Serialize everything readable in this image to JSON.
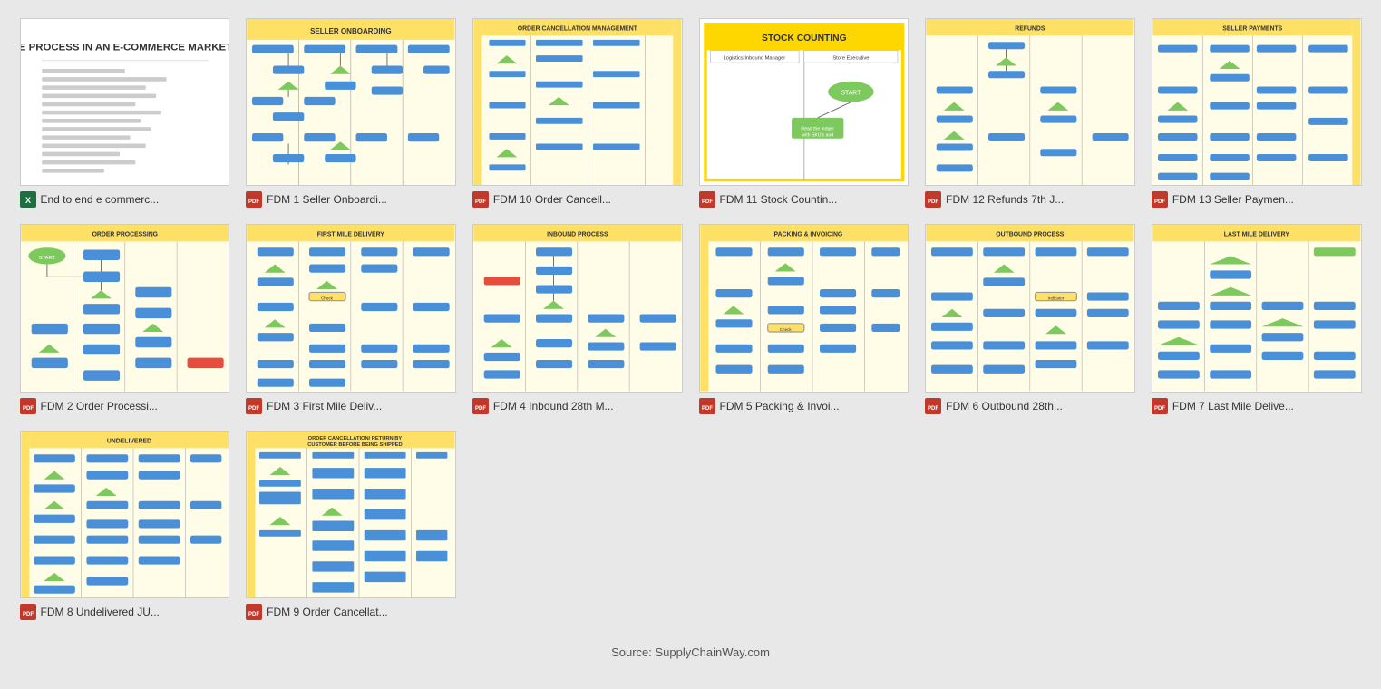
{
  "source": "Source: SupplyChainWay.com",
  "items": [
    {
      "id": "item-0",
      "label": "End to end e commerc...",
      "icon_type": "xlsx",
      "thumb_type": "text_doc"
    },
    {
      "id": "item-1",
      "label": "FDM 1 Seller Onboardi...",
      "icon_type": "pdf",
      "thumb_type": "seller_onboarding"
    },
    {
      "id": "item-2",
      "label": "FDM 10 Order Cancell...",
      "icon_type": "pdf",
      "thumb_type": "order_cancel_10"
    },
    {
      "id": "item-3",
      "label": "FDM 11 Stock Countin...",
      "icon_type": "pdf",
      "thumb_type": "stock_counting"
    },
    {
      "id": "item-4",
      "label": "FDM 12 Refunds 7th J...",
      "icon_type": "pdf",
      "thumb_type": "refunds"
    },
    {
      "id": "item-5",
      "label": "FDM 13 Seller Paymen...",
      "icon_type": "pdf",
      "thumb_type": "seller_payment"
    },
    {
      "id": "item-6",
      "label": "FDM 2 Order Processi...",
      "icon_type": "pdf",
      "thumb_type": "order_processing"
    },
    {
      "id": "item-7",
      "label": "FDM 3 First Mile Deliv...",
      "icon_type": "pdf",
      "thumb_type": "first_mile"
    },
    {
      "id": "item-8",
      "label": "FDM 4 Inbound 28th M...",
      "icon_type": "pdf",
      "thumb_type": "inbound"
    },
    {
      "id": "item-9",
      "label": "FDM 5 Packing & Invoi...",
      "icon_type": "pdf",
      "thumb_type": "packing"
    },
    {
      "id": "item-10",
      "label": "FDM 6 Outbound 28th...",
      "icon_type": "pdf",
      "thumb_type": "outbound"
    },
    {
      "id": "item-11",
      "label": "FDM 7 Last Mile Delive...",
      "icon_type": "pdf",
      "thumb_type": "last_mile"
    },
    {
      "id": "item-12",
      "label": "FDM 8 Undelivered JU...",
      "icon_type": "pdf",
      "thumb_type": "undelivered"
    },
    {
      "id": "item-13",
      "label": "FDM 9 Order Cancellat...",
      "icon_type": "pdf",
      "thumb_type": "order_cancel_9"
    }
  ]
}
